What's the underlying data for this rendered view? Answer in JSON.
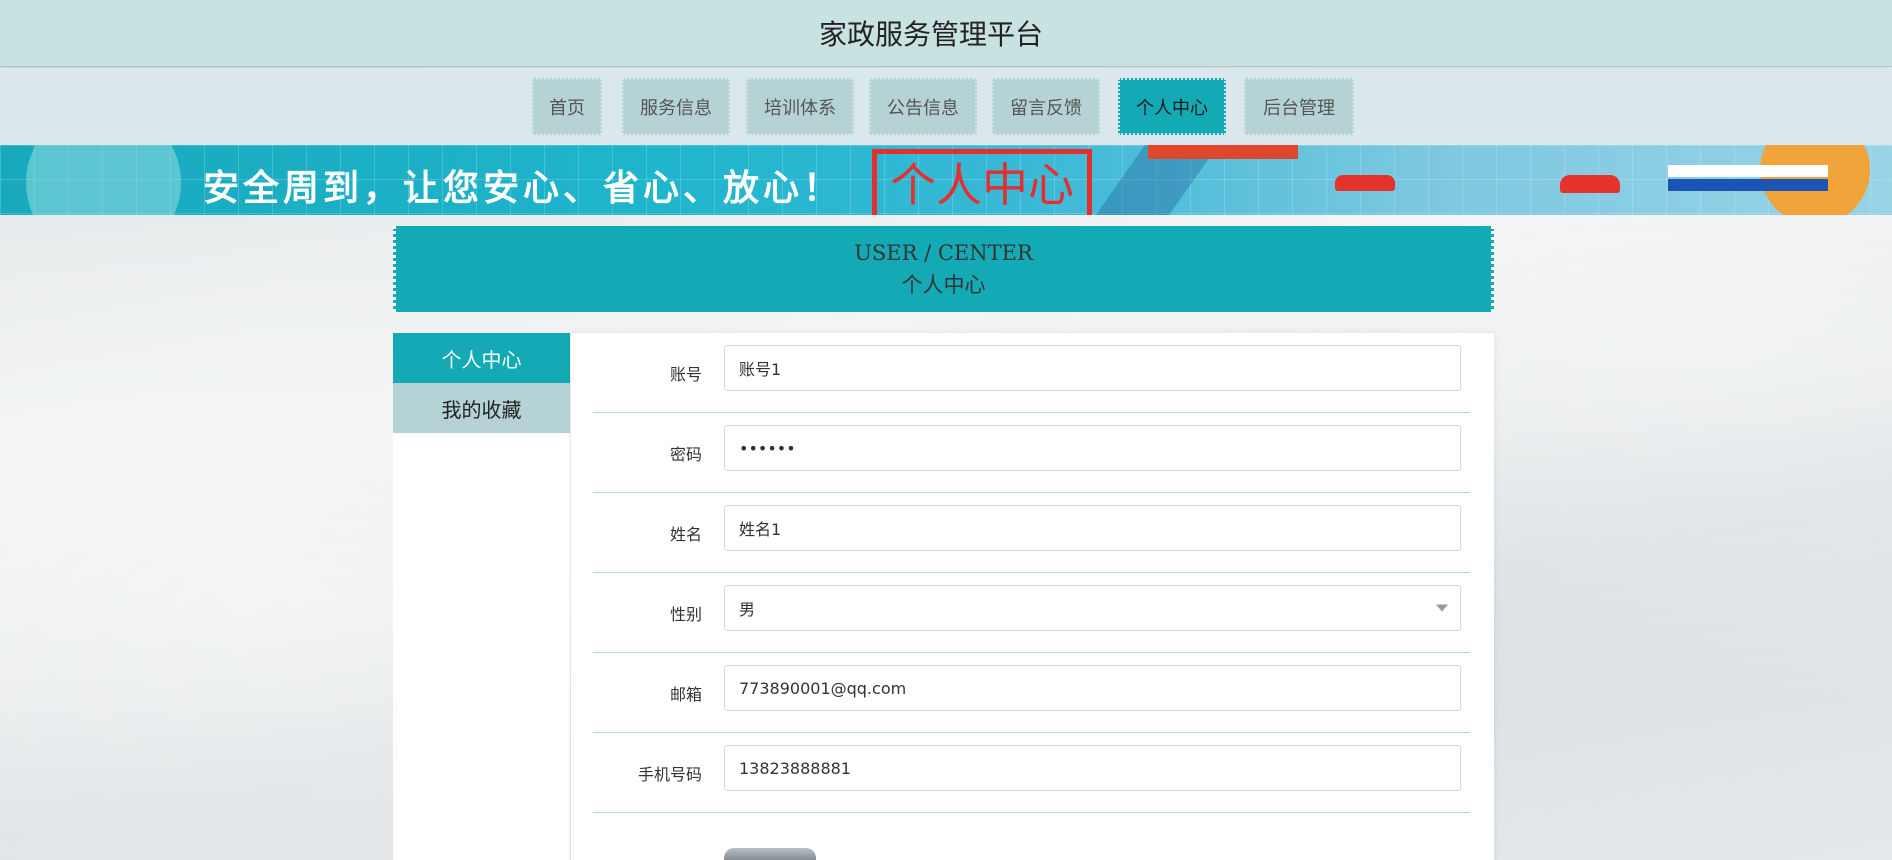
{
  "header": {
    "title": "家政服务管理平台"
  },
  "nav": {
    "items": [
      {
        "label": "首页"
      },
      {
        "label": "服务信息"
      },
      {
        "label": "培训体系"
      },
      {
        "label": "公告信息"
      },
      {
        "label": "留言反馈"
      },
      {
        "label": "个人中心",
        "active": true
      },
      {
        "label": "后台管理"
      }
    ]
  },
  "banner": {
    "slogan": "安全周到，让您安心、省心、放心！",
    "title": "个人中心"
  },
  "section": {
    "title_en": "USER / CENTER",
    "title_cn": "个人中心"
  },
  "side_menu": {
    "items": [
      {
        "label": "个人中心",
        "active": true
      },
      {
        "label": "我的收藏"
      }
    ]
  },
  "form": {
    "account": {
      "label": "账号",
      "value": "账号1"
    },
    "password": {
      "label": "密码",
      "value": "••••••"
    },
    "name": {
      "label": "姓名",
      "value": "姓名1"
    },
    "gender": {
      "label": "性别",
      "value": "男"
    },
    "email": {
      "label": "邮箱",
      "value": "773890001@qq.com"
    },
    "phone": {
      "label": "手机号码",
      "value": "13823888881"
    }
  },
  "colors": {
    "accent": "#13aab5",
    "nav_bg": "#b5d3d4",
    "header_bg": "#c8e2e2",
    "banner_title": "#e3302f"
  },
  "icons": {
    "select_arrow": "chevron-down-icon",
    "avatar": "avatar-image"
  }
}
